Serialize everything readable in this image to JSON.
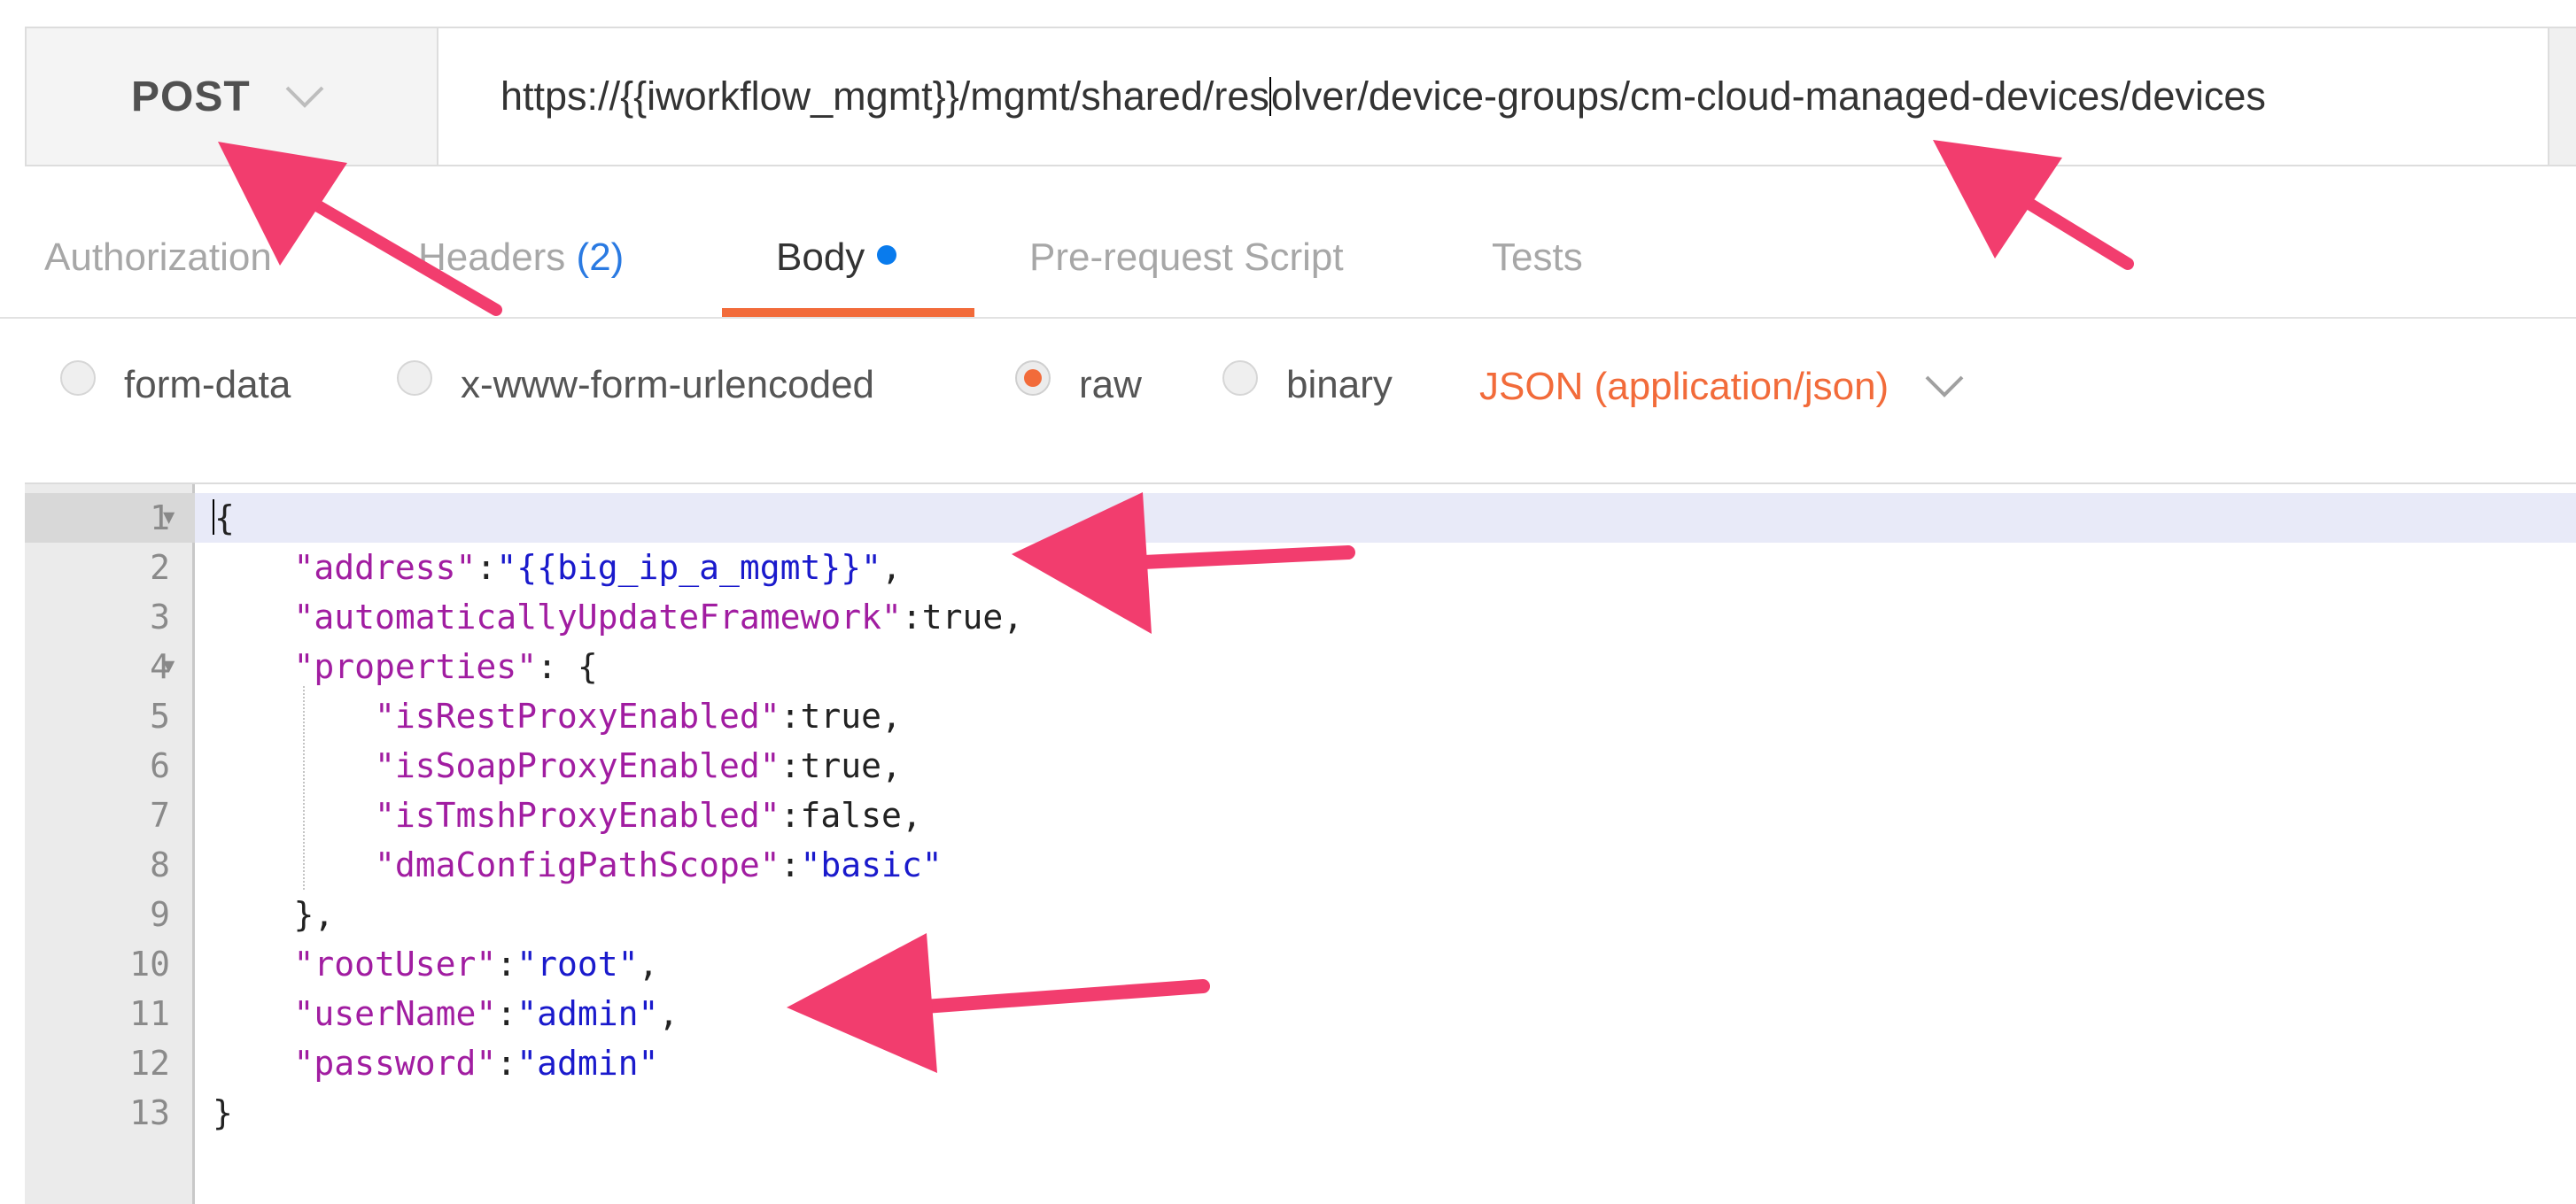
{
  "request": {
    "method": "POST",
    "url": "https://{{iworkflow_mgmt}}/mgmt/shared/resolver/device-groups/cm-cloud-managed-devices/devices",
    "url_before_cursor": "https://{{iworkflow_mgmt}}/mgmt/shared/res",
    "url_after_cursor": "olver/device-groups/cm-cloud-managed-devices/devices"
  },
  "tabs": [
    {
      "label": "Authorization"
    },
    {
      "label": "Headers",
      "count": "(2)"
    },
    {
      "label": "Body",
      "active": true
    },
    {
      "label": "Pre-request Script"
    },
    {
      "label": "Tests"
    }
  ],
  "body_types": [
    {
      "label": "form-data",
      "selected": false
    },
    {
      "label": "x-www-form-urlencoded",
      "selected": false
    },
    {
      "label": "raw",
      "selected": true
    },
    {
      "label": "binary",
      "selected": false
    }
  ],
  "content_type": "JSON (application/json)",
  "editor": {
    "line_numbers": [
      "1",
      "2",
      "3",
      "4",
      "5",
      "6",
      "7",
      "8",
      "9",
      "10",
      "11",
      "12",
      "13"
    ],
    "tokens": {
      "l1_brace": "{",
      "l2_key": "\"address\"",
      "l2_colon": ":",
      "l2_val": "\"{{big_ip_a_mgmt}}\"",
      "l2_comma": ",",
      "l3_key": "\"automaticallyUpdateFramework\"",
      "l3_colon": ":",
      "l3_val": "true",
      "l3_comma": ",",
      "l4_key": "\"properties\"",
      "l4_rest": ": {",
      "l5_key": "\"isRestProxyEnabled\"",
      "l5_colon": ":",
      "l5_val": "true",
      "l5_comma": ",",
      "l6_key": "\"isSoapProxyEnabled\"",
      "l6_colon": ":",
      "l6_val": "true",
      "l6_comma": ",",
      "l7_key": "\"isTmshProxyEnabled\"",
      "l7_colon": ":",
      "l7_val": "false",
      "l7_comma": ",",
      "l8_key": "\"dmaConfigPathScope\"",
      "l8_colon": ":",
      "l8_val": "\"basic\"",
      "l9_close": "},",
      "l10_key": "\"rootUser\"",
      "l10_colon": ":",
      "l10_val": "\"root\"",
      "l10_comma": ",",
      "l11_key": "\"userName\"",
      "l11_colon": ":",
      "l11_val": "\"admin\"",
      "l11_comma": ",",
      "l12_key": "\"password\"",
      "l12_colon": ":",
      "l12_val": "\"admin\"",
      "l13_brace": "}"
    }
  },
  "colors": {
    "accent": "#f26b3a",
    "json_key": "#a11da1",
    "json_string": "#1a1acc",
    "annotation_arrow": "#f23d6e",
    "header_count": "#2a7ae2"
  },
  "icons": {
    "method_dropdown": "chevron-down-icon",
    "content_type_dropdown": "chevron-down-icon",
    "fold": "fold-triangle-icon",
    "annotation": "pink-arrow"
  }
}
